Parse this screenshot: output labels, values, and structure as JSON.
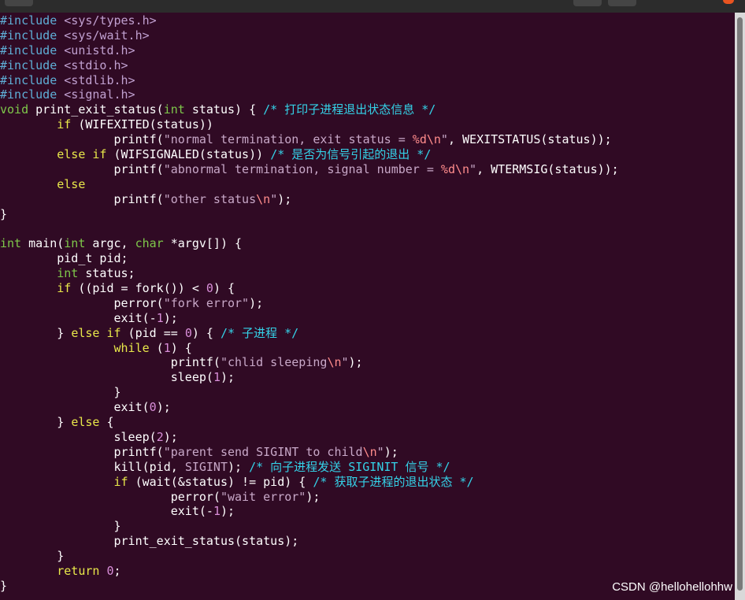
{
  "code_lines": [
    [
      [
        "pp",
        "#include "
      ],
      [
        "hdr",
        "<sys/types.h>"
      ]
    ],
    [
      [
        "pp",
        "#include "
      ],
      [
        "hdr",
        "<sys/wait.h>"
      ]
    ],
    [
      [
        "pp",
        "#include "
      ],
      [
        "hdr",
        "<unistd.h>"
      ]
    ],
    [
      [
        "pp",
        "#include "
      ],
      [
        "hdr",
        "<stdio.h>"
      ]
    ],
    [
      [
        "pp",
        "#include "
      ],
      [
        "hdr",
        "<stdlib.h>"
      ]
    ],
    [
      [
        "pp",
        "#include "
      ],
      [
        "hdr",
        "<signal.h>"
      ]
    ],
    [
      [
        "type",
        "void"
      ],
      [
        "plain",
        " print_exit_status("
      ],
      [
        "type",
        "int"
      ],
      [
        "plain",
        " status) { "
      ],
      [
        "cmt",
        "/* 打印子进程退出状态信息 */"
      ]
    ],
    [
      [
        "plain",
        "        "
      ],
      [
        "kw",
        "if"
      ],
      [
        "plain",
        " (WIFEXITED(status))"
      ]
    ],
    [
      [
        "plain",
        "                printf("
      ],
      [
        "str",
        "\"normal termination, exit status = "
      ],
      [
        "esc",
        "%d\\n"
      ],
      [
        "str",
        "\""
      ],
      [
        "plain",
        ", WEXITSTATUS(status));"
      ]
    ],
    [
      [
        "plain",
        "        "
      ],
      [
        "kw",
        "else if"
      ],
      [
        "plain",
        " (WIFSIGNALED(status)) "
      ],
      [
        "cmt",
        "/* 是否为信号引起的退出 */"
      ]
    ],
    [
      [
        "plain",
        "                printf("
      ],
      [
        "str",
        "\"abnormal termination, signal number = "
      ],
      [
        "esc",
        "%d\\n"
      ],
      [
        "str",
        "\""
      ],
      [
        "plain",
        ", WTERMSIG(status));"
      ]
    ],
    [
      [
        "plain",
        "        "
      ],
      [
        "kw",
        "else"
      ]
    ],
    [
      [
        "plain",
        "                printf("
      ],
      [
        "str",
        "\"other status"
      ],
      [
        "esc",
        "\\n"
      ],
      [
        "str",
        "\""
      ],
      [
        "plain",
        ");"
      ]
    ],
    [
      [
        "plain",
        "}"
      ]
    ],
    [],
    [
      [
        "type",
        "int"
      ],
      [
        "plain",
        " main("
      ],
      [
        "type",
        "int"
      ],
      [
        "plain",
        " argc, "
      ],
      [
        "type",
        "char"
      ],
      [
        "plain",
        " *argv[]) {"
      ]
    ],
    [
      [
        "plain",
        "        pid_t pid;"
      ]
    ],
    [
      [
        "plain",
        "        "
      ],
      [
        "type",
        "int"
      ],
      [
        "plain",
        " status;"
      ]
    ],
    [
      [
        "plain",
        "        "
      ],
      [
        "kw",
        "if"
      ],
      [
        "plain",
        " ((pid = fork()) < "
      ],
      [
        "num",
        "0"
      ],
      [
        "plain",
        ") {"
      ]
    ],
    [
      [
        "plain",
        "                perror("
      ],
      [
        "str",
        "\"fork error\""
      ],
      [
        "plain",
        ");"
      ]
    ],
    [
      [
        "plain",
        "                exit(-"
      ],
      [
        "num",
        "1"
      ],
      [
        "plain",
        ");"
      ]
    ],
    [
      [
        "plain",
        "        } "
      ],
      [
        "kw",
        "else if"
      ],
      [
        "plain",
        " (pid == "
      ],
      [
        "num",
        "0"
      ],
      [
        "plain",
        ") { "
      ],
      [
        "cmt",
        "/* 子进程 */"
      ]
    ],
    [
      [
        "plain",
        "                "
      ],
      [
        "kw",
        "while"
      ],
      [
        "plain",
        " ("
      ],
      [
        "num",
        "1"
      ],
      [
        "plain",
        ") {"
      ]
    ],
    [
      [
        "plain",
        "                        printf("
      ],
      [
        "str",
        "\"chlid sleeping"
      ],
      [
        "esc",
        "\\n"
      ],
      [
        "str",
        "\""
      ],
      [
        "plain",
        ");"
      ]
    ],
    [
      [
        "plain",
        "                        sleep("
      ],
      [
        "num",
        "1"
      ],
      [
        "plain",
        ");"
      ]
    ],
    [
      [
        "plain",
        "                }"
      ]
    ],
    [
      [
        "plain",
        "                exit("
      ],
      [
        "num",
        "0"
      ],
      [
        "plain",
        ");"
      ]
    ],
    [
      [
        "plain",
        "        } "
      ],
      [
        "kw",
        "else"
      ],
      [
        "plain",
        " {"
      ]
    ],
    [
      [
        "plain",
        "                sleep("
      ],
      [
        "num",
        "2"
      ],
      [
        "plain",
        ");"
      ]
    ],
    [
      [
        "plain",
        "                printf("
      ],
      [
        "str",
        "\"parent send SIGINT to child"
      ],
      [
        "esc",
        "\\n"
      ],
      [
        "str",
        "\""
      ],
      [
        "plain",
        ");"
      ]
    ],
    [
      [
        "plain",
        "                kill(pid, "
      ],
      [
        "str",
        "SIGINT"
      ],
      [
        "plain",
        "); "
      ],
      [
        "cmt",
        "/* 向子进程发送 SIGINIT 信号 */"
      ]
    ],
    [
      [
        "plain",
        "                "
      ],
      [
        "kw",
        "if"
      ],
      [
        "plain",
        " (wait(&status) != pid) { "
      ],
      [
        "cmt",
        "/* 获取子进程的退出状态 */"
      ]
    ],
    [
      [
        "plain",
        "                        perror("
      ],
      [
        "str",
        "\"wait error\""
      ],
      [
        "plain",
        ");"
      ]
    ],
    [
      [
        "plain",
        "                        exit(-"
      ],
      [
        "num",
        "1"
      ],
      [
        "plain",
        ");"
      ]
    ],
    [
      [
        "plain",
        "                }"
      ]
    ],
    [
      [
        "plain",
        "                print_exit_status(status);"
      ]
    ],
    [
      [
        "plain",
        "        }"
      ]
    ],
    [
      [
        "plain",
        "        "
      ],
      [
        "kw",
        "return"
      ],
      [
        "plain",
        " "
      ],
      [
        "num",
        "0"
      ],
      [
        "plain",
        ";"
      ]
    ],
    [
      [
        "plain",
        "}"
      ]
    ]
  ],
  "watermark": "CSDN @hellohellohhw",
  "colors": {
    "background": "#300a24",
    "preprocessor": "#5fafd7",
    "type": "#7ec84a",
    "keyword": "#e8e84a",
    "string": "#c8a8c8",
    "number": "#d98ed9",
    "comment": "#34d2e8"
  }
}
